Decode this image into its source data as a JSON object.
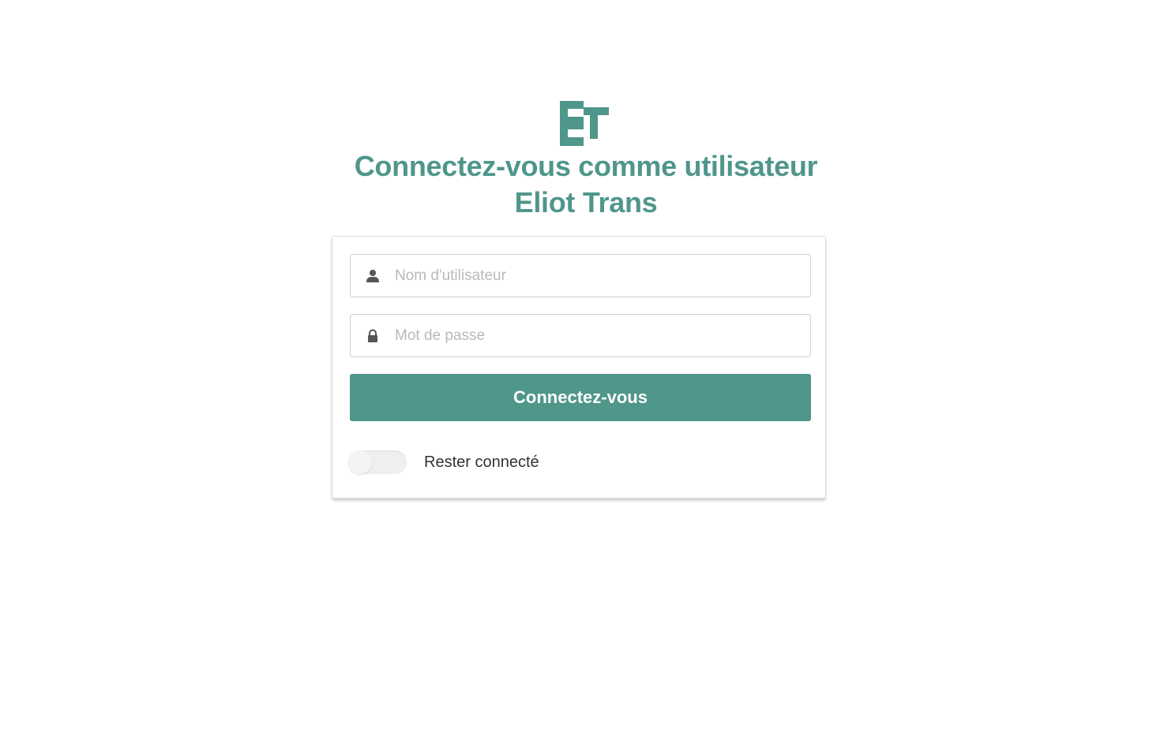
{
  "brand": {
    "logo_icon": "eliot-trans-logo",
    "accent_color": "#4f968b"
  },
  "heading": {
    "line1": "Connectez-vous comme utilisateur",
    "line2": "Eliot Trans"
  },
  "form": {
    "username": {
      "icon": "user-icon",
      "placeholder": "Nom d'utilisateur",
      "value": ""
    },
    "password": {
      "icon": "lock-icon",
      "placeholder": "Mot de passe",
      "value": ""
    },
    "submit_label": "Connectez-vous",
    "remember_label": "Rester connecté",
    "remember_checked": false
  }
}
